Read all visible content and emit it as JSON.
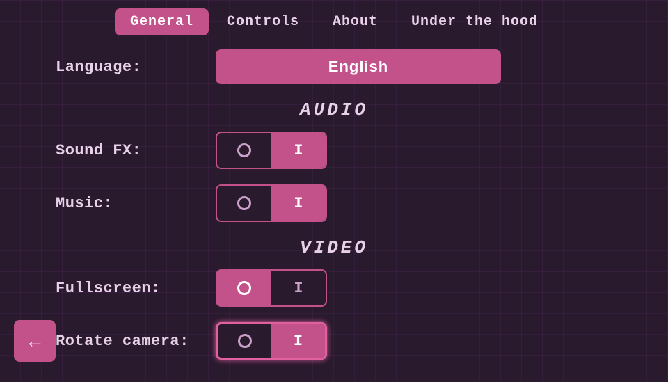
{
  "tabs": [
    {
      "id": "general",
      "label": "General",
      "active": true
    },
    {
      "id": "controls",
      "label": "Controls",
      "active": false
    },
    {
      "id": "about",
      "label": "About",
      "active": false
    },
    {
      "id": "under-the-hood",
      "label": "Under the hood",
      "active": false
    }
  ],
  "settings": {
    "language": {
      "label": "Language:",
      "value": "English"
    },
    "audio_header": "AUDIO",
    "sound_fx": {
      "label": "Sound FX:",
      "off_symbol": "O",
      "on_symbol": "I",
      "state": "on"
    },
    "music": {
      "label": "Music:",
      "off_symbol": "O",
      "on_symbol": "I",
      "state": "on"
    },
    "video_header": "VIDEO",
    "fullscreen": {
      "label": "Fullscreen:",
      "off_symbol": "O",
      "on_symbol": "I",
      "state": "off"
    },
    "rotate_camera": {
      "label": "Rotate camera:",
      "off_symbol": "O",
      "on_symbol": "I",
      "state": "on",
      "highlighted": true
    }
  },
  "back_button": {
    "arrow": "←"
  }
}
